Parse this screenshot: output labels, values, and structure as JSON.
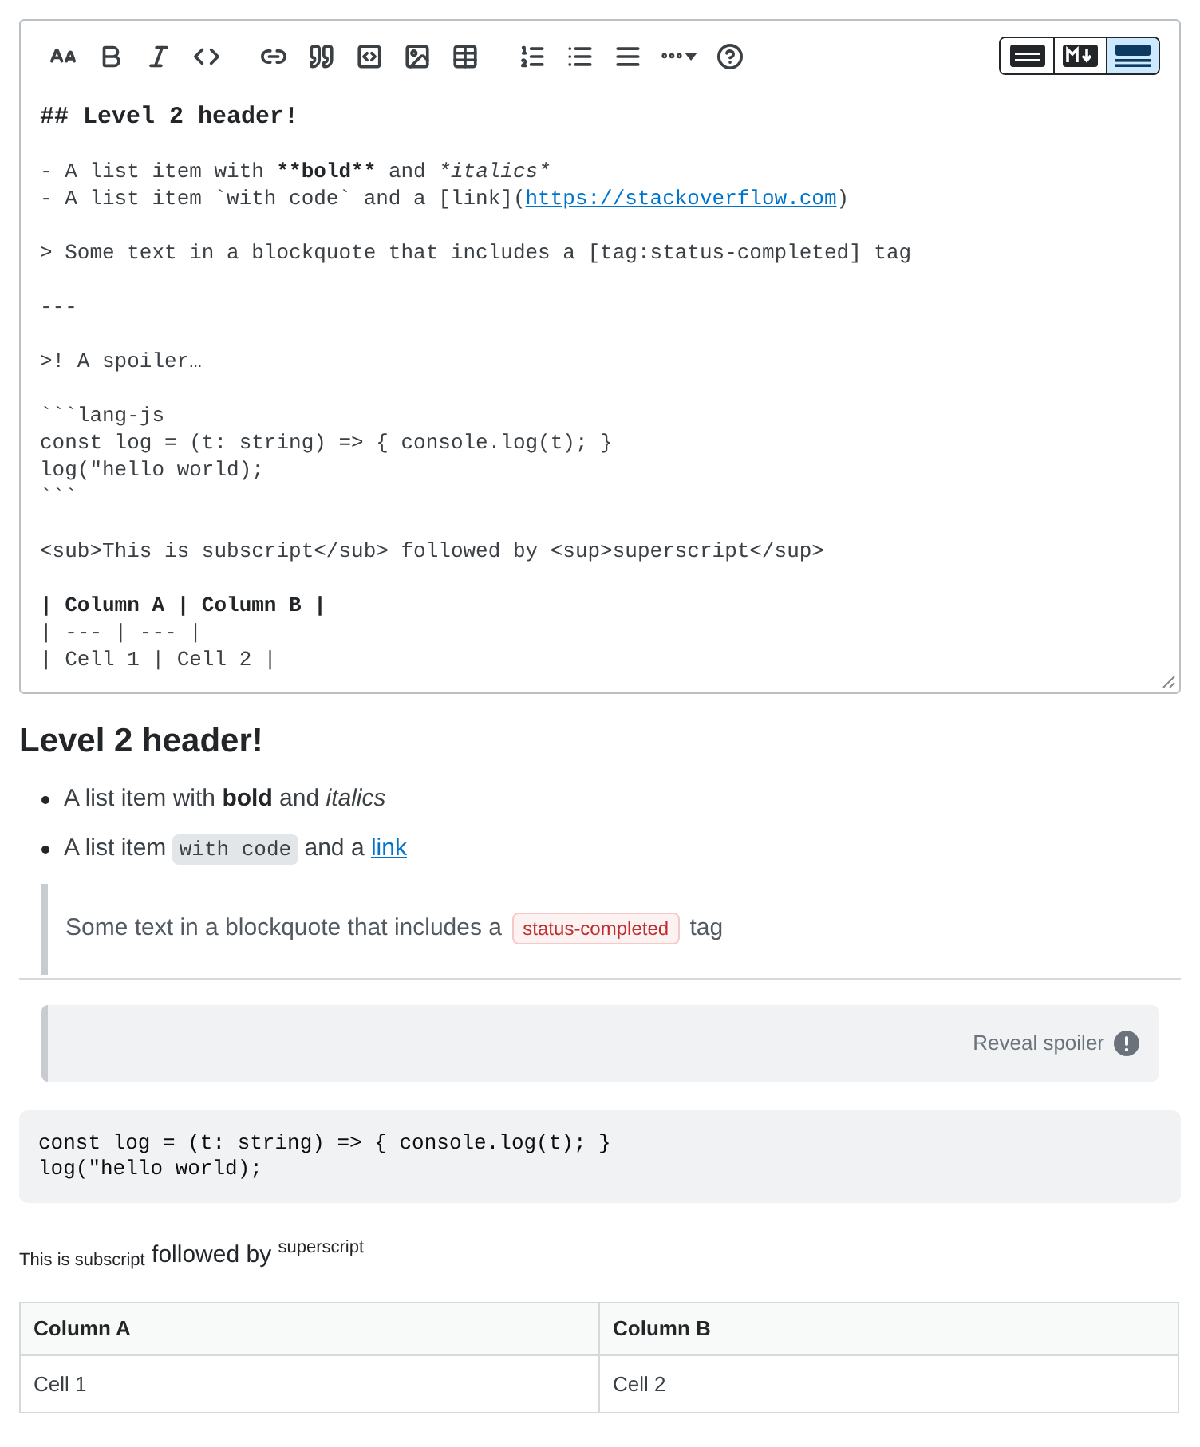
{
  "toolbar": [
    {
      "kind": "heading"
    },
    {
      "kind": "bold"
    },
    {
      "kind": "italic"
    },
    {
      "kind": "code"
    },
    {
      "kind": "link"
    },
    {
      "kind": "quote"
    },
    {
      "kind": "codeblock"
    },
    {
      "kind": "image"
    },
    {
      "kind": "table"
    },
    {
      "kind": "ordered-list"
    },
    {
      "kind": "bullet-list"
    },
    {
      "kind": "rule"
    },
    {
      "kind": "more"
    },
    {
      "kind": "help"
    }
  ],
  "view_modes": [
    {
      "kind": "rich",
      "selected": false
    },
    {
      "kind": "markdown",
      "selected": false
    },
    {
      "kind": "split",
      "selected": true
    }
  ],
  "editor_blocks": [
    [
      [
        {
          "text": "## Level 2 header!",
          "kind": "heading"
        }
      ]
    ],
    [
      [
        {
          "text": "- A list item with ",
          "kind": "plain"
        },
        {
          "text": "**bold**",
          "kind": "bold"
        },
        {
          "text": " and ",
          "kind": "plain"
        },
        {
          "text": "*italics*",
          "kind": "italic"
        }
      ],
      [
        {
          "text": "- A list item `with code` and a [link](",
          "kind": "plain"
        },
        {
          "text": "https://stackoverflow.com",
          "kind": "link"
        },
        {
          "text": ")",
          "kind": "plain"
        }
      ]
    ],
    [
      [
        {
          "text": "> Some text in a blockquote that includes a [tag:status-completed] tag",
          "kind": "plain"
        }
      ]
    ],
    [
      [
        {
          "text": "---",
          "kind": "plain"
        }
      ]
    ],
    [
      [
        {
          "text": ">! A spoiler…",
          "kind": "plain"
        }
      ]
    ],
    [
      [
        {
          "text": "```lang-js",
          "kind": "plain"
        }
      ],
      [
        {
          "text": "const log = (t: string) => { console.log(t); }",
          "kind": "plain"
        }
      ],
      [
        {
          "text": "log(\"hello world);",
          "kind": "plain"
        }
      ],
      [
        {
          "text": "```",
          "kind": "plain"
        }
      ]
    ],
    [
      [
        {
          "text": "<sub>This is subscript</sub> followed by <sup>superscript</sup>",
          "kind": "plain"
        }
      ]
    ],
    [
      [
        {
          "text": "| Column A | Column B |",
          "kind": "bold"
        }
      ],
      [
        {
          "text": "| --- | --- |",
          "kind": "plain"
        }
      ],
      [
        {
          "text": "| Cell 1 | Cell 2 |",
          "kind": "plain"
        }
      ]
    ]
  ],
  "preview": {
    "heading": "Level 2 header!",
    "list_items": [
      [
        {
          "text": "A list item with ",
          "kind": "plain"
        },
        {
          "text": "bold",
          "kind": "bold"
        },
        {
          "text": " and ",
          "kind": "plain"
        },
        {
          "text": "italics",
          "kind": "italic"
        }
      ],
      [
        {
          "text": "A list item ",
          "kind": "plain"
        },
        {
          "text": "with code",
          "kind": "code"
        },
        {
          "text": " and a ",
          "kind": "plain"
        },
        {
          "text": "link",
          "kind": "link"
        }
      ]
    ],
    "blockquote": [
      {
        "text": "Some text in a blockquote that includes a ",
        "kind": "plain"
      },
      {
        "text": "status-completed",
        "kind": "tag"
      },
      {
        "text": " tag",
        "kind": "plain"
      }
    ],
    "spoiler": {
      "label": "Reveal spoiler"
    },
    "code_lines": [
      "const log = (t: string) => { console.log(t); }",
      "log(\"hello world);"
    ],
    "sub_sup": "$_{This is subscript}$ followed by $^{superscript}$",
    "table": {
      "columns": [
        "Column A",
        "Column B"
      ],
      "rows": [
        [
          "Cell 1",
          "Cell 2"
        ]
      ]
    }
  }
}
